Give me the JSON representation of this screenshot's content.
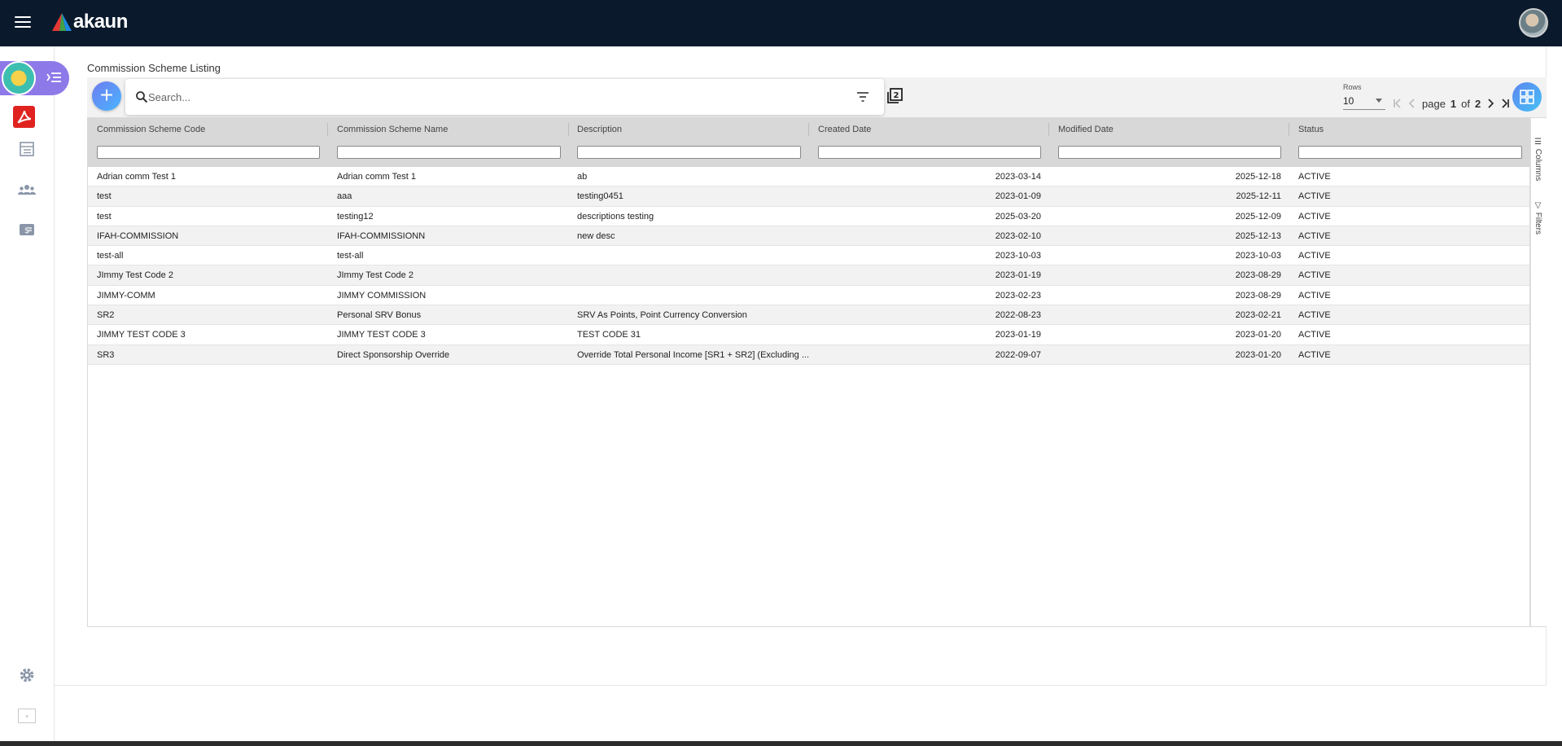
{
  "app": {
    "brand": "akaun",
    "brand_colors": [
      "#e53935",
      "#43a047",
      "#1e88e5"
    ]
  },
  "page": {
    "title": "Commission Scheme Listing"
  },
  "search": {
    "placeholder": "Search..."
  },
  "pagination": {
    "rows_label": "Rows",
    "rows_value": "10",
    "page_label": "page",
    "current_page": "1",
    "of_label": "of",
    "total_pages": "2"
  },
  "table": {
    "columns": [
      "Commission Scheme Code",
      "Commission Scheme Name",
      "Description",
      "Created Date",
      "Modified Date",
      "Status"
    ],
    "rows": [
      [
        "Adrian comm Test 1",
        "Adrian comm Test 1",
        "ab",
        "2023-03-14",
        "2025-12-18",
        "ACTIVE"
      ],
      [
        "test",
        "aaa",
        "testing0451",
        "2023-01-09",
        "2025-12-11",
        "ACTIVE"
      ],
      [
        "test",
        "testing12",
        "descriptions testing",
        "2025-03-20",
        "2025-12-09",
        "ACTIVE"
      ],
      [
        "IFAH-COMMISSION",
        "IFAH-COMMISSIONN",
        "new desc",
        "2023-02-10",
        "2025-12-13",
        "ACTIVE"
      ],
      [
        "test-all",
        "test-all",
        "",
        "2023-10-03",
        "2023-10-03",
        "ACTIVE"
      ],
      [
        "JImmy Test Code 2",
        "JImmy Test Code 2",
        "",
        "2023-01-19",
        "2023-08-29",
        "ACTIVE"
      ],
      [
        "JIMMY-COMM",
        "JIMMY COMMISSION",
        "",
        "2023-02-23",
        "2023-08-29",
        "ACTIVE"
      ],
      [
        "SR2",
        "Personal SRV Bonus",
        "SRV As Points, Point Currency Conversion",
        "2022-08-23",
        "2023-02-21",
        "ACTIVE"
      ],
      [
        "JIMMY TEST CODE 3",
        "JIMMY TEST CODE 3",
        "TEST CODE 31",
        "2023-01-19",
        "2023-01-20",
        "ACTIVE"
      ],
      [
        "SR3",
        "Direct Sponsorship Override",
        "Override Total Personal Income [SR1 + SR2] (Excluding ...",
        "2022-09-07",
        "2023-01-20",
        "ACTIVE"
      ]
    ]
  },
  "side_tabs": {
    "columns": "Columns",
    "filters": "Filters"
  },
  "sidebar": {
    "icons": [
      "apps-icon",
      "acrobat-icon",
      "list-icon",
      "team-icon",
      "payment-icon",
      "settings-icon",
      "broken-image-icon"
    ]
  }
}
